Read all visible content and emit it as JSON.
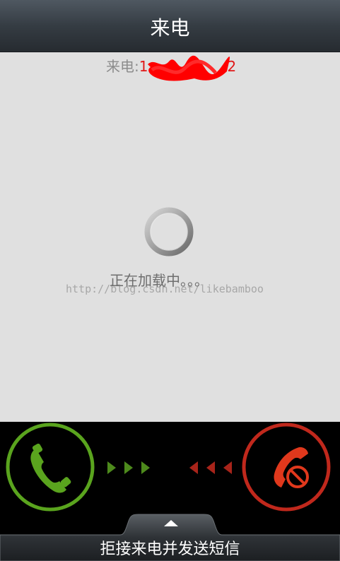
{
  "header": {
    "title": "来电"
  },
  "caller": {
    "prefix": "来电:",
    "number_visible_start": "1",
    "number_visible_end": "2"
  },
  "status": {
    "loading_text": "正在加载中。。。"
  },
  "watermark": {
    "text": "http://blog.csdn.net/likebamboo"
  },
  "actions": {
    "answer_icon": "phone-answer-icon",
    "decline_icon": "phone-decline-icon",
    "sms_reject_label": "拒接来电并发送短信"
  },
  "colors": {
    "answer": "#5aa41e",
    "decline": "#c0281c",
    "background": "#e0e0e0"
  }
}
